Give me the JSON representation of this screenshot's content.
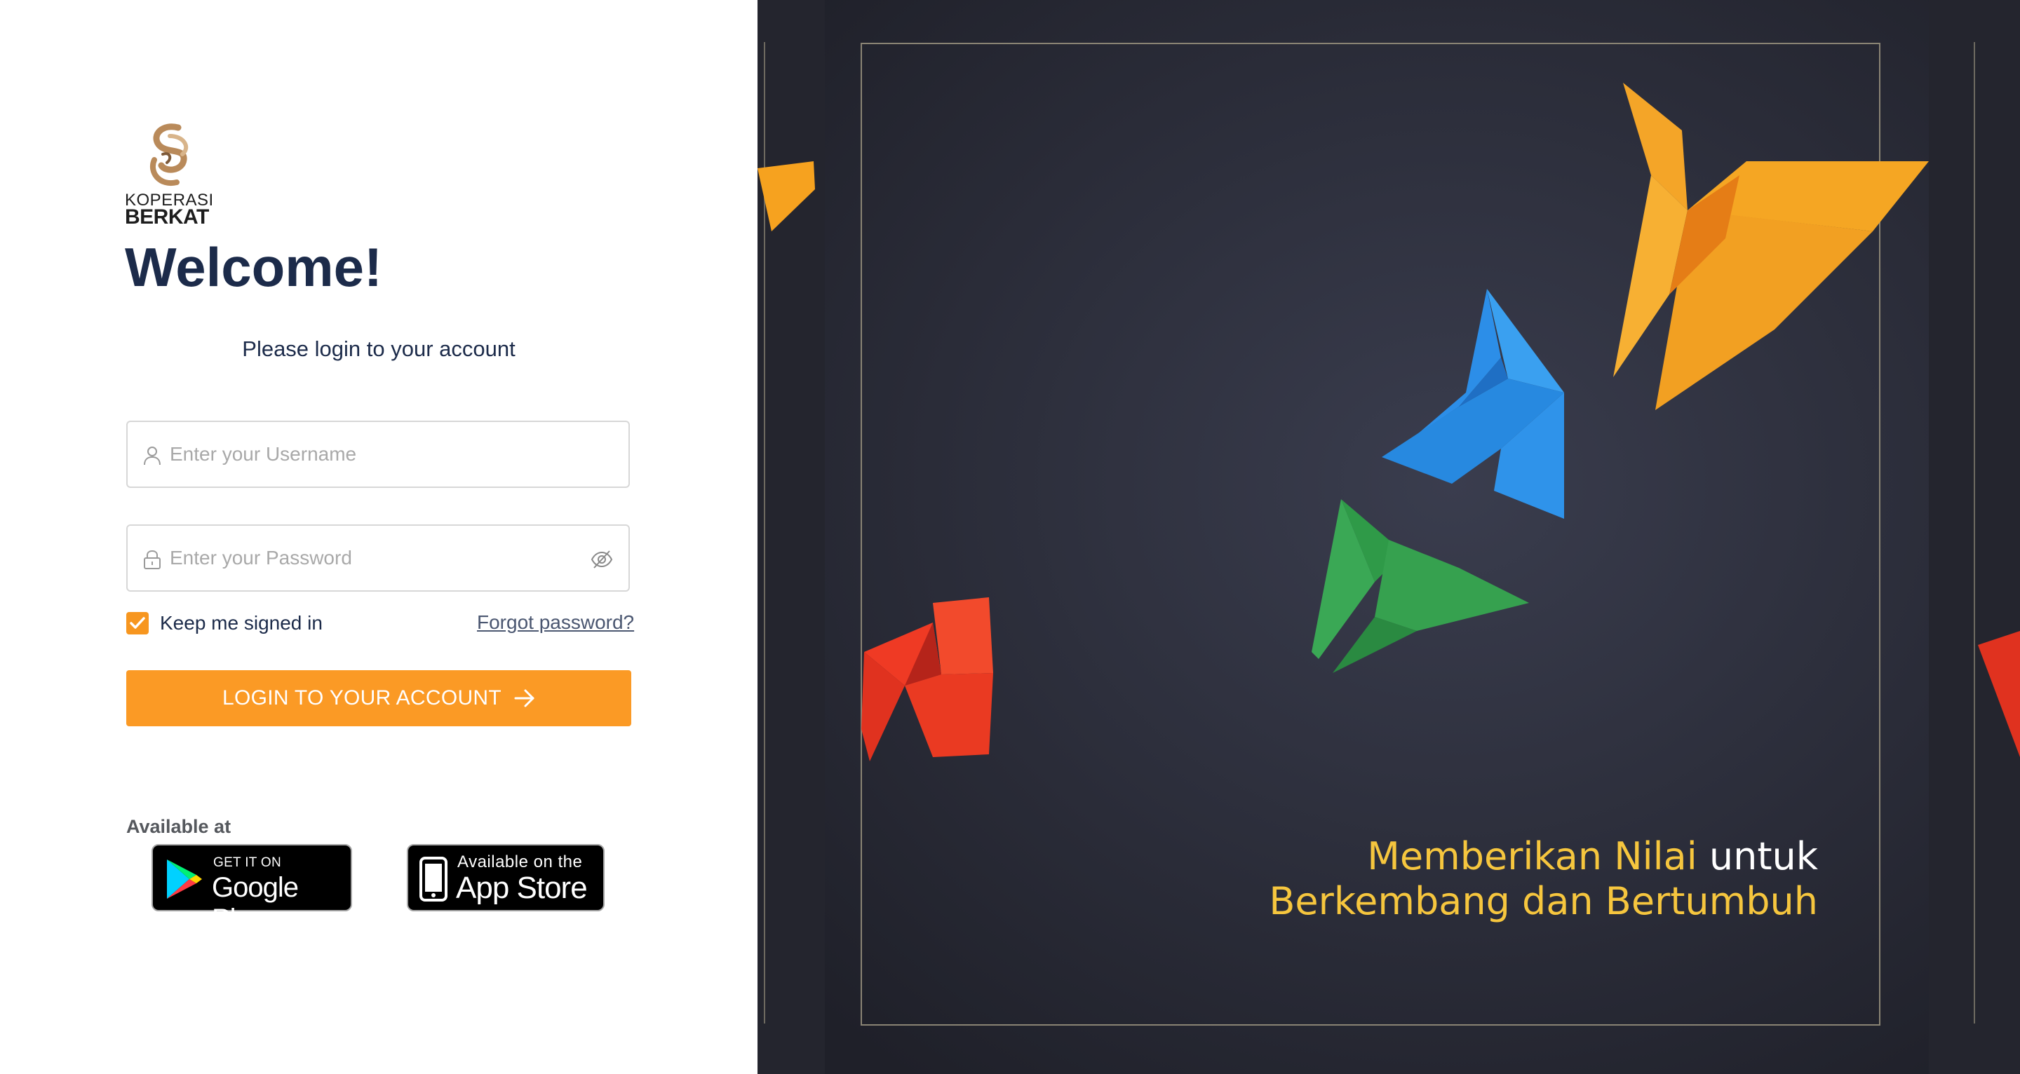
{
  "brand": {
    "logo_line1": "KOPERASI",
    "logo_line2": "BERKAT"
  },
  "login": {
    "title": "Welcome!",
    "subtitle": "Please login to your account",
    "username_placeholder": "Enter your Username",
    "password_placeholder": "Enter your Password",
    "remember_label": "Keep me signed in",
    "remember_checked": true,
    "forgot_label": "Forgot password?",
    "submit_label": "LOGIN TO YOUR ACCOUNT",
    "accent_color": "#fb9a25"
  },
  "stores": {
    "heading": "Available at",
    "google_small": "GET IT ON",
    "google_big": "Google Play",
    "apple_small": "Available on the",
    "apple_big": "App Store"
  },
  "hero": {
    "line1_highlight": "Memberikan Nilai",
    "line1_rest": "untuk",
    "line2": "Berkembang dan Bertumbuh",
    "background_color": "#282a36",
    "text_highlight_color": "#f6c63e"
  },
  "icons": {
    "username": "user-icon",
    "password": "lock-icon",
    "toggle": "eye-slash-icon",
    "submit": "arrow-right-icon",
    "checkbox": "check-icon"
  }
}
